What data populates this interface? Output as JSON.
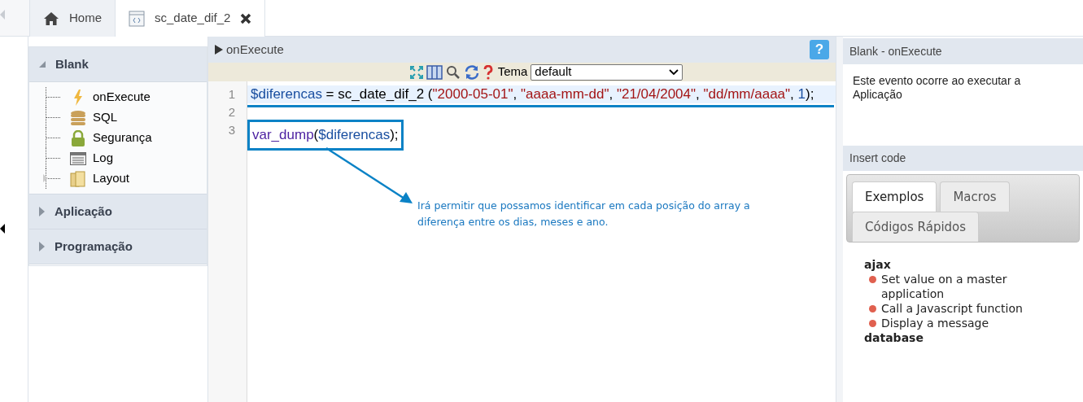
{
  "tabs": [
    {
      "label": "Home",
      "kind": "home",
      "selected": false
    },
    {
      "label": "sc_date_dif_2",
      "kind": "code",
      "selected": true,
      "closable": true
    }
  ],
  "sidebar": {
    "sections": [
      {
        "title": "Blank",
        "expanded": true,
        "children": [
          {
            "label": "onExecute",
            "kind": "bolt"
          },
          {
            "label": "SQL",
            "kind": "database"
          },
          {
            "label": "Segurança",
            "kind": "lock"
          },
          {
            "label": "Log",
            "kind": "log"
          },
          {
            "label": "Layout",
            "kind": "layout",
            "expandable": true
          }
        ]
      },
      {
        "title": "Aplicação",
        "expanded": false
      },
      {
        "title": "Programação",
        "expanded": false
      }
    ]
  },
  "editor": {
    "title": "onExecute",
    "help": "?",
    "theme_label": "Tema",
    "theme_value": "default",
    "lines": [
      {
        "number": "1",
        "active": true,
        "tokens": [
          {
            "kind": "variable",
            "text": "$diferencas"
          },
          {
            "kind": "plain",
            "text": " = sc_date_dif_2 ("
          },
          {
            "kind": "string",
            "text": "\"2000-05-01\""
          },
          {
            "kind": "plain",
            "text": ", "
          },
          {
            "kind": "string",
            "text": "\"aaaa-mm-dd\""
          },
          {
            "kind": "plain",
            "text": ", "
          },
          {
            "kind": "string",
            "text": "\"21/04/2004\""
          },
          {
            "kind": "plain",
            "text": ", "
          },
          {
            "kind": "string",
            "text": "\"dd/mm/aaaa\""
          },
          {
            "kind": "plain",
            "text": ", "
          },
          {
            "kind": "number",
            "text": "1"
          },
          {
            "kind": "plain",
            "text": ");"
          }
        ]
      },
      {
        "number": "2",
        "active": false
      },
      {
        "number": "3",
        "active": false,
        "tokens": [
          {
            "kind": "function",
            "text": "var_dump"
          },
          {
            "kind": "plain",
            "text": "("
          },
          {
            "kind": "variable",
            "text": "$diferencas"
          },
          {
            "kind": "plain",
            "text": ");"
          }
        ]
      }
    ],
    "annotation": "Irá permitir que possamos identificar em cada posição do array a diferença entre os dias, meses e ano."
  },
  "info_panel": {
    "title": "Blank - onExecute",
    "description": "Este evento ocorre ao executar a Aplicação"
  },
  "insert_code": {
    "title": "Insert code",
    "tabs": [
      {
        "label": "Exemplos",
        "selected": true
      },
      {
        "label": "Macros",
        "selected": false
      },
      {
        "label": "Códigos Rápidos",
        "selected": false
      }
    ],
    "groups": [
      {
        "name": "ajax",
        "items": [
          {
            "label": "Set value on a master application",
            "color": "#e0604f"
          },
          {
            "label": "Call a Javascript function",
            "color": "#e0604f"
          },
          {
            "label": "Display a message",
            "color": "#e0604f"
          }
        ]
      },
      {
        "name": "database"
      }
    ]
  }
}
